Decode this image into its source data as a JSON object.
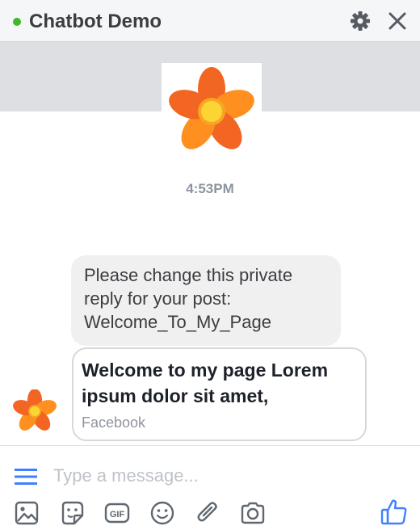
{
  "header": {
    "title": "Chatbot Demo",
    "status": "online",
    "status_color": "#42b72a"
  },
  "conversation": {
    "timestamp": "4:53PM",
    "messages": [
      {
        "type": "text",
        "text": "Please change this private reply for your post: Welcome_To_My_Page"
      },
      {
        "type": "card",
        "title": "Welcome to my page Lorem ipsum dolor sit amet,",
        "subtitle": "Facebook"
      }
    ]
  },
  "composer": {
    "placeholder": "Type a message...",
    "tools": [
      "image-icon",
      "sticker-icon",
      "gif-icon",
      "emoji-icon",
      "attachment-icon",
      "camera-icon"
    ],
    "send_icon": "thumbs-up-icon",
    "accent": "#4080ff"
  }
}
